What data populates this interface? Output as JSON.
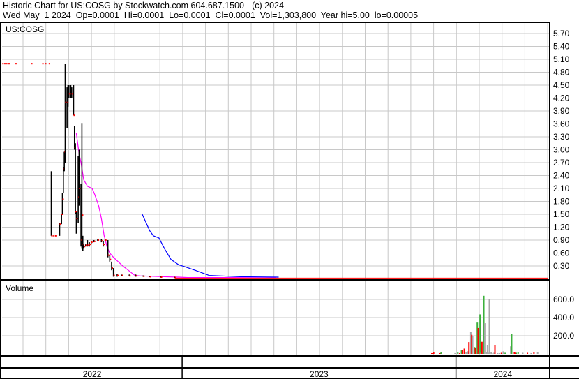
{
  "header": {
    "title": "Historic Chart for US:COSG by Stockwatch.com 604.687.1500 - (c) 2024",
    "quote_line": "Wed May  1 2024  Op=0.0001  Hi=0.0001  Lo=0.0001  Cl=0.0001  Vol=1,303,800  Year hi=5.00  lo=0.00005"
  },
  "chart_data": {
    "type": "line",
    "symbol_label": "US:COSG",
    "volume_label": "Volume",
    "x_unit": "trading-day index",
    "xlim": [
      0,
      590
    ],
    "price_axis": {
      "ylim": [
        0,
        5.9
      ],
      "ticks": [
        "0.30",
        "0.60",
        "0.90",
        "1.20",
        "1.50",
        "1.80",
        "2.10",
        "2.40",
        "2.70",
        "3.00",
        "3.30",
        "3.60",
        "3.90",
        "4.20",
        "4.50",
        "4.80",
        "5.10",
        "5.40",
        "5.70"
      ],
      "grid": true
    },
    "volume_axis": {
      "ylim": [
        0,
        760
      ],
      "ticks": [
        "200.0",
        "400.0",
        "600.0"
      ],
      "unit": "thousands",
      "grid": true
    },
    "year_labels": [
      {
        "label": "2022",
        "start": 0,
        "end": 194
      },
      {
        "label": "2023",
        "start": 194,
        "end": 489
      },
      {
        "label": "2024",
        "start": 489,
        "end": 590
      }
    ],
    "year_high_marks": {
      "value": 5.0,
      "days": [
        1,
        3,
        5,
        7,
        8,
        15,
        32,
        44,
        47,
        51
      ],
      "color": "#ff0000"
    },
    "price_bars_hlc": [
      [
        53,
        2.5,
        1.0,
        1.0
      ],
      [
        55,
        1.0,
        1.0,
        1.0
      ],
      [
        57,
        1.0,
        1.0,
        1.0
      ],
      [
        62,
        1.3,
        1.0,
        1.27
      ],
      [
        64,
        1.5,
        1.27,
        1.5
      ],
      [
        65,
        2.0,
        1.5,
        1.85
      ],
      [
        66,
        2.6,
        2.0,
        2.56
      ],
      [
        67,
        2.95,
        2.5,
        2.95
      ],
      [
        68,
        5.0,
        2.7,
        4.1
      ],
      [
        70,
        4.45,
        3.5,
        4.1
      ],
      [
        71,
        4.5,
        4.0,
        4.35
      ],
      [
        72,
        4.5,
        4.2,
        4.3
      ],
      [
        74,
        4.5,
        4.2,
        4.3
      ],
      [
        75,
        4.45,
        4.2,
        4.3
      ],
      [
        77,
        4.5,
        3.8,
        3.8
      ],
      [
        78,
        3.55,
        3.0,
        3.05
      ],
      [
        79,
        3.15,
        1.5,
        1.55
      ],
      [
        80,
        1.55,
        1.05,
        1.4
      ],
      [
        82,
        2.85,
        1.3,
        1.9
      ],
      [
        83,
        3.0,
        1.7,
        2.1
      ],
      [
        85,
        2.2,
        0.75,
        0.9
      ],
      [
        86,
        3.62,
        0.7,
        1.48
      ],
      [
        87,
        1.0,
        0.65,
        0.8
      ],
      [
        88,
        0.8,
        0.7,
        0.75
      ],
      [
        90,
        0.8,
        0.75,
        0.78
      ],
      [
        92,
        0.9,
        0.75,
        0.78
      ],
      [
        94,
        0.85,
        0.75,
        0.8
      ],
      [
        96,
        0.88,
        0.8,
        0.85
      ],
      [
        99,
        0.9,
        0.85,
        0.87
      ],
      [
        103,
        0.92,
        0.88,
        0.9
      ],
      [
        107,
        0.92,
        0.85,
        0.88
      ],
      [
        109,
        0.88,
        0.75,
        0.8
      ],
      [
        111,
        0.92,
        0.88,
        0.9
      ],
      [
        114,
        0.9,
        0.5,
        0.55
      ],
      [
        116,
        0.55,
        0.4,
        0.45
      ],
      [
        118,
        0.4,
        0.2,
        0.25
      ],
      [
        120,
        0.25,
        0.05,
        0.08
      ],
      [
        124,
        0.12,
        0.05,
        0.08
      ],
      [
        129,
        0.1,
        0.06,
        0.08
      ],
      [
        137,
        0.1,
        0.06,
        0.07
      ],
      [
        144,
        0.1,
        0.05,
        0.07
      ],
      [
        152,
        0.08,
        0.05,
        0.06
      ],
      [
        159,
        0.07,
        0.04,
        0.05
      ],
      [
        171,
        0.06,
        0.03,
        0.04
      ],
      [
        186,
        0.05,
        0.02,
        0.03
      ]
    ],
    "price_tail": {
      "from": 186,
      "to": 588,
      "value": 0.01,
      "color": "#ff0000"
    },
    "series": [
      {
        "name": "Short moving average",
        "color": "#ff00ff",
        "points": [
          [
            80,
            3.38
          ],
          [
            83,
            2.9
          ],
          [
            85,
            2.7
          ],
          [
            88,
            2.3
          ],
          [
            92,
            2.15
          ],
          [
            97,
            2.1
          ],
          [
            100,
            1.95
          ],
          [
            104,
            1.7
          ],
          [
            107,
            1.4
          ],
          [
            110,
            1.0
          ],
          [
            113,
            0.75
          ],
          [
            116,
            0.6
          ],
          [
            120,
            0.5
          ],
          [
            125,
            0.4
          ],
          [
            130,
            0.3
          ],
          [
            136,
            0.2
          ],
          [
            143,
            0.08
          ],
          [
            148,
            0.07
          ],
          [
            175,
            0.05
          ],
          [
            190,
            0.04
          ],
          [
            200,
            0.03
          ],
          [
            250,
            0.03
          ],
          [
            295,
            0.02
          ]
        ]
      },
      {
        "name": "Long moving average",
        "color": "#0000ff",
        "points": [
          [
            151,
            1.5
          ],
          [
            159,
            1.12
          ],
          [
            163,
            1.0
          ],
          [
            169,
            0.95
          ],
          [
            175,
            0.7
          ],
          [
            182,
            0.45
          ],
          [
            190,
            0.33
          ],
          [
            197,
            0.28
          ],
          [
            208,
            0.2
          ],
          [
            223,
            0.08
          ],
          [
            257,
            0.05
          ],
          [
            298,
            0.04
          ]
        ]
      }
    ],
    "volume_bars": [
      [
        463,
        8,
        "red"
      ],
      [
        465,
        15,
        "red"
      ],
      [
        472,
        8,
        "red"
      ],
      [
        473,
        15,
        "green"
      ],
      [
        488,
        8,
        "gray"
      ],
      [
        491,
        20,
        "green"
      ],
      [
        493,
        8,
        "red"
      ],
      [
        495,
        43,
        "green"
      ],
      [
        496,
        45,
        "red"
      ],
      [
        498,
        58,
        "red"
      ],
      [
        500,
        20,
        "gray"
      ],
      [
        502,
        28,
        "gray"
      ],
      [
        503,
        130,
        "red"
      ],
      [
        505,
        240,
        "gray"
      ],
      [
        506,
        210,
        "red"
      ],
      [
        507,
        200,
        "gray"
      ],
      [
        509,
        75,
        "green"
      ],
      [
        510,
        70,
        "red"
      ],
      [
        512,
        345,
        "green"
      ],
      [
        513,
        285,
        "red"
      ],
      [
        514,
        20,
        "gray"
      ],
      [
        515,
        435,
        "green"
      ],
      [
        516,
        13,
        "gray"
      ],
      [
        517,
        133,
        "red"
      ],
      [
        519,
        640,
        "green"
      ],
      [
        520,
        338,
        "gray"
      ],
      [
        522,
        20,
        "gray"
      ],
      [
        523,
        95,
        "gray"
      ],
      [
        524,
        12,
        "gray"
      ],
      [
        525,
        600,
        "gray"
      ],
      [
        527,
        20,
        "gray"
      ],
      [
        528,
        8,
        "gray"
      ],
      [
        530,
        12,
        "gray"
      ],
      [
        531,
        98,
        "red"
      ],
      [
        534,
        8,
        "gray"
      ],
      [
        536,
        8,
        "gray"
      ],
      [
        538,
        12,
        "red"
      ],
      [
        540,
        28,
        "gray"
      ],
      [
        542,
        12,
        "green"
      ],
      [
        548,
        83,
        "gray"
      ],
      [
        549,
        217,
        "green"
      ],
      [
        552,
        20,
        "red"
      ],
      [
        553,
        12,
        "red"
      ],
      [
        554,
        12,
        "green"
      ],
      [
        556,
        20,
        "green"
      ],
      [
        561,
        12,
        "gray"
      ],
      [
        566,
        12,
        "red"
      ],
      [
        570,
        8,
        "gray"
      ],
      [
        573,
        20,
        "red"
      ],
      [
        577,
        20,
        "gray"
      ]
    ],
    "colors": {
      "red": "#ff0000",
      "green": "#3cb03c",
      "gray": "#a8a8a8",
      "grid": "#c8c8c8",
      "bar": "#000000"
    }
  }
}
